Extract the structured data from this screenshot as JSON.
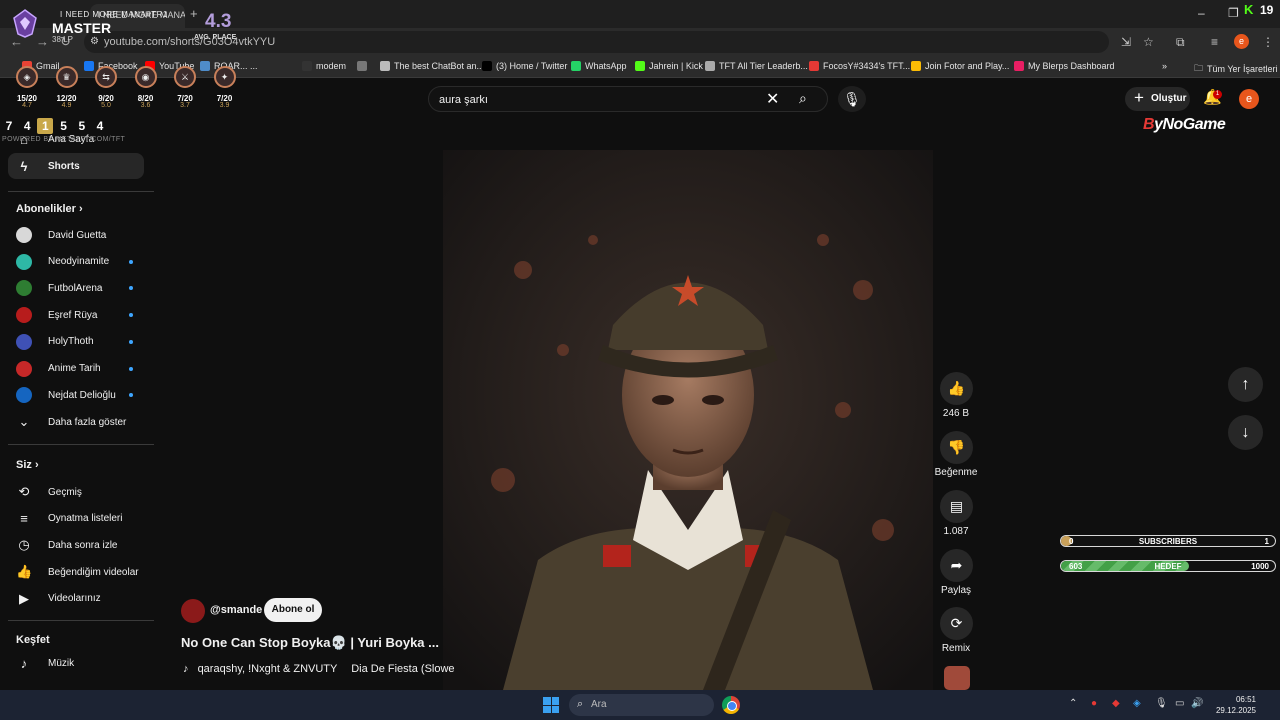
{
  "browser": {
    "tab_title": "I NEED MORE MANA#TR1",
    "new_tab": "+",
    "url": "youtube.com/shorts/G03O4vtkYYU",
    "window_controls": [
      "–",
      "❐",
      "✕"
    ]
  },
  "bookmarks": [
    {
      "label": "Gmail",
      "icon": "gmail-icon",
      "color": "#ea4335"
    },
    {
      "label": "Facebook",
      "icon": "facebook-icon",
      "color": "#1877f2"
    },
    {
      "label": "YouTube",
      "icon": "youtube-icon",
      "color": "#ff0000"
    },
    {
      "label": "ROAR... ...",
      "icon": "globe-icon",
      "color": "#4f8cc9"
    },
    {
      "label": "modem",
      "icon": "z-icon",
      "color": "#333333"
    },
    {
      "label": "",
      "icon": "globe-icon",
      "color": "#777777"
    },
    {
      "label": "The best ChatBot an...",
      "icon": "chatbot-icon",
      "color": "#bbbbbb"
    },
    {
      "label": "(3) Home / Twitter",
      "icon": "x-icon",
      "color": "#000000"
    },
    {
      "label": "WhatsApp",
      "icon": "whatsapp-icon",
      "color": "#25d366"
    },
    {
      "label": "Jahrein | Kick",
      "icon": "kick-icon",
      "color": "#53fc18"
    },
    {
      "label": "TFT All Tier Leaderb...",
      "icon": "tft-icon",
      "color": "#aaaaaa"
    },
    {
      "label": "FocosY#3434's TFT...",
      "icon": "tft-stats-icon",
      "color": "#e53935"
    },
    {
      "label": "Join Fotor and Play...",
      "icon": "fotor-icon",
      "color": "#fbbc05"
    },
    {
      "label": "My Blerps Dashboard",
      "icon": "blerp-icon",
      "color": "#e91e63"
    }
  ],
  "bookmarks_more": "»",
  "bookmarks_all": "Tüm Yer İşaretleri",
  "header": {
    "search_value": "aura şarkı",
    "create_label": "Oluştur",
    "notification_count": "1",
    "avatar_letter": "e"
  },
  "sidebar": {
    "home": "Ana Sayfa",
    "shorts": "Shorts",
    "subscriptions_title": "Abonelikler",
    "channels": [
      {
        "name": "David Guetta",
        "color": "#d8d8d8",
        "new": false
      },
      {
        "name": "Neodyinamite",
        "color": "#2eb8a6",
        "new": true
      },
      {
        "name": "FutbolArena",
        "color": "#2e7d32",
        "new": true
      },
      {
        "name": "Eşref Rüya",
        "color": "#b71c1c",
        "new": true
      },
      {
        "name": "HolyThoth",
        "color": "#3f51b5",
        "new": true
      },
      {
        "name": "Anime Tarih",
        "color": "#c62828",
        "new": true
      },
      {
        "name": "Nejdat Delioğlu",
        "color": "#1565c0",
        "new": true
      }
    ],
    "show_more": "Daha fazla göster",
    "you_title": "Siz",
    "you_items": [
      "Geçmiş",
      "Oynatma listeleri",
      "Daha sonra izle",
      "Beğendiğim videolar",
      "Videolarınız"
    ],
    "explore_title": "Keşfet",
    "explore_items": [
      "Müzik"
    ]
  },
  "video": {
    "channel_handle": "@smande",
    "subscribe_label": "Abone ol",
    "title": "No One Can Stop Boyka💀 | Yuri Boyka ...",
    "music_artist": "qaraqshy, !Nxght & ZNVUTY",
    "music_track": "Dia De Fiesta (Slowe"
  },
  "actions": {
    "like_count": "246 B",
    "dislike_label": "Beğenme",
    "comment_count": "1.087",
    "share_label": "Paylaş",
    "remix_label": "Remix"
  },
  "tft_overlay": {
    "streamer": "I NEED MORE MANA#TR1",
    "rank": "MASTER",
    "lp": "38 LP",
    "avg_place": "4.3",
    "avg_label": "AVG. PLACE",
    "champions": [
      {
        "stat": "15/20",
        "sub": "4.7"
      },
      {
        "stat": "12/20",
        "sub": "4.9"
      },
      {
        "stat": "9/20",
        "sub": "5.0"
      },
      {
        "stat": "8/20",
        "sub": "3.6"
      },
      {
        "stat": "7/20",
        "sub": "3.7"
      },
      {
        "stat": "7/20",
        "sub": "3.9"
      }
    ],
    "placements": [
      "7",
      "4",
      "1",
      "5",
      "5",
      "4"
    ],
    "powered": "POWERED BY METATFT.COM/TFT"
  },
  "bynogame": {
    "mark": "B",
    "text": "yNoGame"
  },
  "goals": {
    "subscribers": {
      "current": "0",
      "label": "SUBSCRIBERS",
      "target": "1",
      "progress": 0.05
    },
    "hedef": {
      "current": "603",
      "label": "HEDEF",
      "target": "1000",
      "progress": 0.6
    }
  },
  "kick": {
    "logo": "K",
    "count": "19"
  },
  "taskbar": {
    "search_placeholder": "Ara",
    "time": "06:51",
    "date": "29.12.2025"
  }
}
